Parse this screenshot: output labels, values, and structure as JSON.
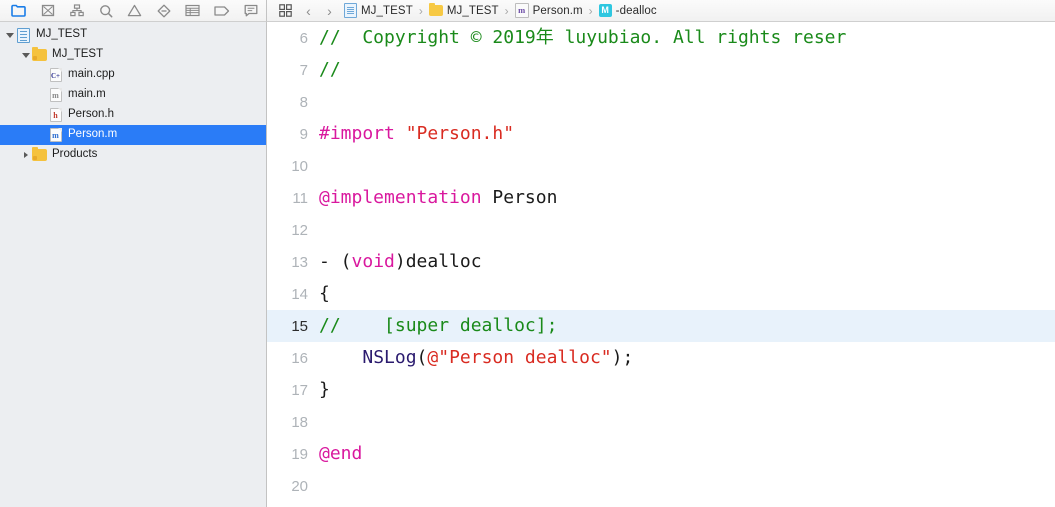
{
  "navigator_toolbar": {
    "buttons": [
      {
        "name": "folder-icon",
        "label": "Show the Project navigator",
        "active": true
      },
      {
        "name": "source-control-icon",
        "label": "Show the Source Control navigator",
        "active": false
      },
      {
        "name": "symbol-hierarchy-icon",
        "label": "Show the Symbol navigator",
        "active": false
      },
      {
        "name": "search-icon",
        "label": "Show the Find navigator",
        "active": false
      },
      {
        "name": "warning-triangle-icon",
        "label": "Show the Issue navigator",
        "active": false
      },
      {
        "name": "test-diamond-icon",
        "label": "Show the Test navigator",
        "active": false
      },
      {
        "name": "debug-list-icon",
        "label": "Show the Debug navigator",
        "active": false
      },
      {
        "name": "breakpoint-tag-icon",
        "label": "Show the Breakpoint navigator",
        "active": false
      },
      {
        "name": "report-message-icon",
        "label": "Show the Report navigator",
        "active": false
      }
    ]
  },
  "jumpbar": {
    "grid_icon": "related-items-icon",
    "back_arrow": "‹",
    "forward_arrow": "›",
    "separator": "›",
    "breadcrumbs": [
      {
        "icon": "project-document-icon",
        "label": "MJ_TEST"
      },
      {
        "icon": "folder-icon",
        "label": "MJ_TEST"
      },
      {
        "icon": "objc-implementation-file-icon",
        "label": "Person.m"
      },
      {
        "icon": "method-badge-icon",
        "label": "-dealloc"
      }
    ]
  },
  "navigator_tree": [
    {
      "label": "MJ_TEST",
      "depth": 0,
      "icon": "project-document-icon",
      "twisty": "open",
      "selected": false
    },
    {
      "label": "MJ_TEST",
      "depth": 1,
      "icon": "folder-icon",
      "twisty": "open",
      "selected": false
    },
    {
      "label": "main.cpp",
      "depth": 2,
      "icon": "cpp-file-icon",
      "twisty": "none",
      "selected": false
    },
    {
      "label": "main.m",
      "depth": 2,
      "icon": "objc-file-icon",
      "twisty": "none",
      "selected": false
    },
    {
      "label": "Person.h",
      "depth": 2,
      "icon": "header-file-icon",
      "twisty": "none",
      "selected": false
    },
    {
      "label": "Person.m",
      "depth": 2,
      "icon": "objc-file-icon",
      "twisty": "none",
      "selected": true
    },
    {
      "label": "Products",
      "depth": 1,
      "icon": "folder-icon",
      "twisty": "closed",
      "selected": false
    }
  ],
  "editor": {
    "lines": [
      {
        "num": "6",
        "active": false,
        "tokens": [
          {
            "t": "//  Copyright © 2019年 luyubiao. All rights reser",
            "c": "comment"
          }
        ]
      },
      {
        "num": "7",
        "active": false,
        "tokens": [
          {
            "t": "//",
            "c": "comment"
          }
        ]
      },
      {
        "num": "8",
        "active": false,
        "tokens": []
      },
      {
        "num": "9",
        "active": false,
        "tokens": [
          {
            "t": "#import",
            "c": "key"
          },
          {
            "t": " ",
            "c": "plain"
          },
          {
            "t": "\"Person.h\"",
            "c": "str"
          }
        ]
      },
      {
        "num": "10",
        "active": false,
        "tokens": []
      },
      {
        "num": "11",
        "active": false,
        "tokens": [
          {
            "t": "@implementation",
            "c": "key"
          },
          {
            "t": " Person",
            "c": "plain"
          }
        ]
      },
      {
        "num": "12",
        "active": false,
        "tokens": []
      },
      {
        "num": "13",
        "active": false,
        "tokens": [
          {
            "t": "- (",
            "c": "plain"
          },
          {
            "t": "void",
            "c": "key"
          },
          {
            "t": ")dealloc",
            "c": "plain"
          }
        ]
      },
      {
        "num": "14",
        "active": false,
        "tokens": [
          {
            "t": "{",
            "c": "plain"
          }
        ]
      },
      {
        "num": "15",
        "active": true,
        "tokens": [
          {
            "t": "//    [super dealloc];",
            "c": "comment"
          }
        ]
      },
      {
        "num": "16",
        "active": false,
        "tokens": [
          {
            "t": "    ",
            "c": "plain"
          },
          {
            "t": "NSLog",
            "c": "fn"
          },
          {
            "t": "(",
            "c": "plain"
          },
          {
            "t": "@\"Person dealloc\"",
            "c": "str"
          },
          {
            "t": ");",
            "c": "plain"
          }
        ]
      },
      {
        "num": "17",
        "active": false,
        "tokens": [
          {
            "t": "}",
            "c": "plain"
          }
        ]
      },
      {
        "num": "18",
        "active": false,
        "tokens": []
      },
      {
        "num": "19",
        "active": false,
        "tokens": [
          {
            "t": "@end",
            "c": "key"
          }
        ]
      },
      {
        "num": "20",
        "active": false,
        "tokens": []
      }
    ]
  },
  "colors": {
    "selection_blue": "#2a7cf7",
    "active_line_bg": "#e8f2fb",
    "comment_green": "#1a8a1a",
    "keyword_magenta": "#d9189e",
    "string_red": "#d92b21",
    "function_navy": "#2a1a6e",
    "navigator_bg": "#eceef1"
  }
}
